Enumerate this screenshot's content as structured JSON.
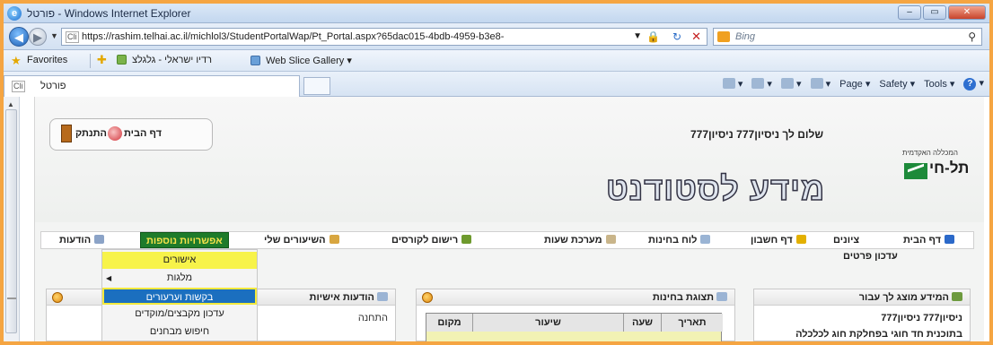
{
  "window": {
    "title": "פורטל - Windows Internet Explorer",
    "buttons": {
      "min": "–",
      "max": "▭",
      "close": "✕"
    }
  },
  "address": {
    "url": "https://rashim.telhai.ac.il/michlol3/StudentPortalWap/Pt_Portal.aspx?65dac015-4bdb-4959-b3e8-",
    "search_placeholder": "Bing"
  },
  "favorites": {
    "label": "Favorites",
    "item1": "רדיו ישראלי - גלגלצ",
    "item2": "Web Slice Gallery"
  },
  "tab": {
    "label": "פורטל"
  },
  "commands": [
    "Page",
    "Safety",
    "Tools"
  ],
  "page": {
    "home_button": "דף הבית",
    "logout_button": "התנתק",
    "greeting": "שלום לך ניסיון777 ניסיון777",
    "college_small": "המכללה האקדמית",
    "college_name": "תל-חי",
    "big_title": "מידע לסטודנט",
    "menu": [
      "דף הבית",
      "ציונים",
      "דף חשבון",
      "לוח בחינות",
      "מערכת שעות",
      "רישום לקורסים",
      "השיעורים שלי",
      "אפשרויות נוספות",
      "הודעות"
    ],
    "submenu_label": "עדכון פרטים",
    "dropdown": [
      "אישורים",
      "מלגות",
      "בקשות וערעורים",
      "עדכון מקבצים/מוקדים",
      "חיפוש מבחנים"
    ],
    "panels": {
      "messages_title": "הודעות אישיות",
      "messages_body": "התחנה",
      "exams_title": "תצוגת בחינות",
      "exams_cols": [
        "תאריך",
        "שעה",
        "שיעור",
        "מקום"
      ],
      "info_title": "המידע מוצג לך עבור",
      "info_line1": "ניסיון777 ניסיון777",
      "info_line2": "בתוכנית חד חוגי בפחלקת חוג לכלכלה"
    }
  }
}
